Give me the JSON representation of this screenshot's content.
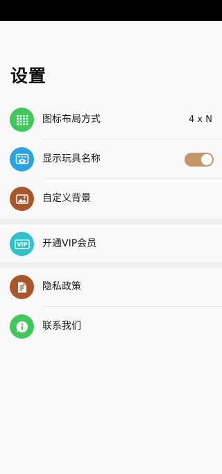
{
  "page": {
    "title": "设置"
  },
  "colors": {
    "status_bar": "#000000",
    "background": "#f9f9f9",
    "green": "#3ec95a",
    "blue": "#2aa3e0",
    "brown": "#a9562a",
    "teal": "#2fc3c9",
    "toggle_on": "#c69766"
  },
  "settings": {
    "layout": {
      "label": "图标布局方式",
      "value": "4 x N",
      "icon": "grid-icon"
    },
    "show_names": {
      "label": "显示玩具名称",
      "toggle_on": true,
      "icon": "eye-icon"
    },
    "background": {
      "label": "自定义背景",
      "icon": "picture-icon"
    }
  },
  "vip": {
    "label": "开通VIP会员",
    "icon_text": "VIP",
    "icon": "vip-icon"
  },
  "about": {
    "privacy": {
      "label": "隐私政策",
      "icon": "document-icon"
    },
    "contact": {
      "label": "联系我们",
      "icon": "info-chat-icon"
    }
  }
}
